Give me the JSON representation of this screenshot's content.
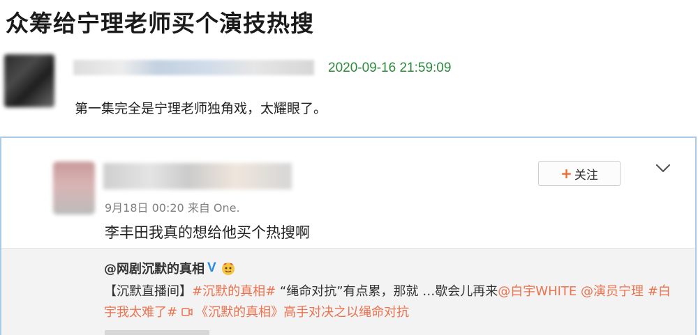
{
  "headline": "众筹给宁理老师买个演技热搜",
  "first_comment": {
    "timestamp": "2020-09-16 21:59:09",
    "text": "第一集完全是宁理老师独角戏，太耀眼了。"
  },
  "weibo_post": {
    "follow_label": "关注",
    "follow_plus": "+",
    "meta": "9月18日 00:20 来自 One.",
    "text": "李丰田我真的想给他买个热搜啊",
    "quoted": {
      "author": "@网剧沉默的真相",
      "verified_badge": "V",
      "text_prefix": "【沉默直播间】",
      "hashtag_1": "#沉默的真相#",
      "text_middle": " “绳命对抗”有点累，那就 …歇会儿再来",
      "mention_1": "@白宇WHITE",
      "mention_2": "@演员宁理",
      "hashtag_2": "#白宇我太难了#",
      "video_link": "《沉默的真相》高手对决之以绳命对抗"
    }
  },
  "colors": {
    "timestamp_green": "#2e8b3e",
    "link_orange": "#eb7350",
    "card_border": "#a9cbe8",
    "verified_blue": "#2c8be0"
  },
  "icons": {
    "chevron": "chevron-down-icon",
    "verified": "verified-badge-icon",
    "emoji": "emoji-icon",
    "video": "video-icon"
  }
}
